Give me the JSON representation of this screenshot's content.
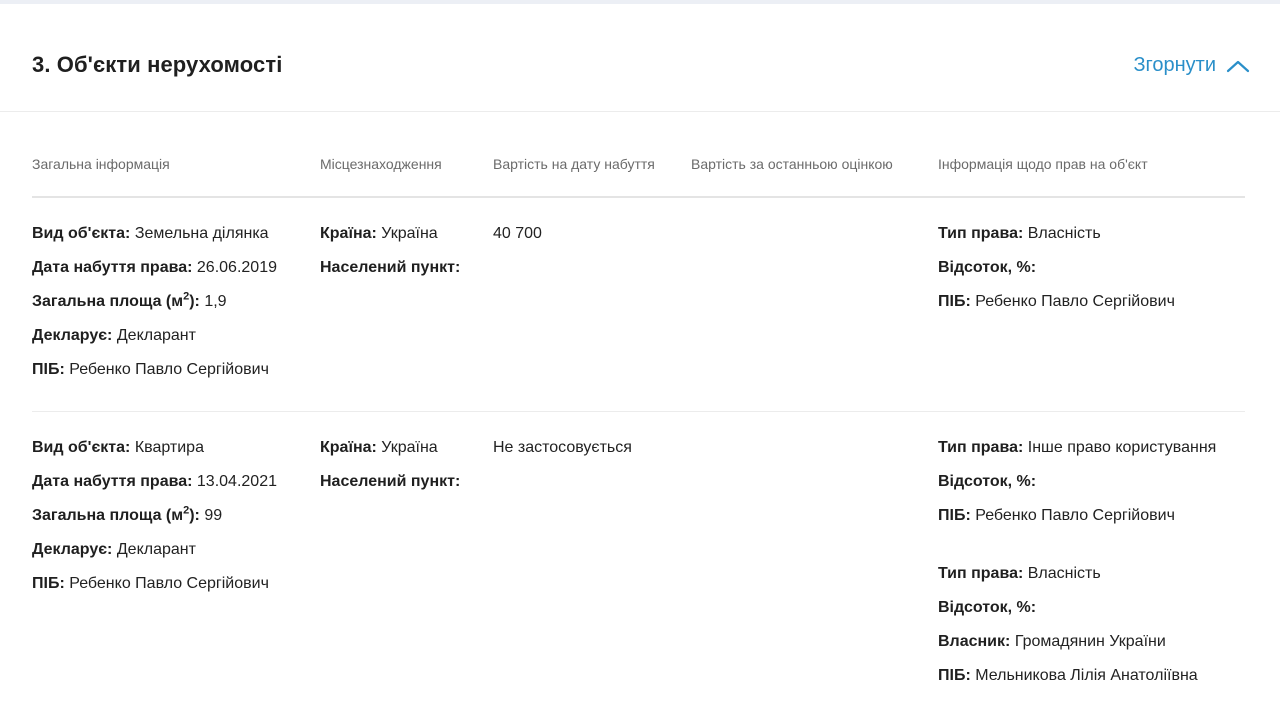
{
  "section": {
    "title": "3. Об'єкти нерухомості",
    "collapse_label": "Згорнути"
  },
  "columns": [
    "Загальна інформація",
    "Місцезнаходження",
    "Вартість на дату набуття",
    "Вартість за останньою оцінкою",
    "Інформація щодо прав на об'єкт"
  ],
  "labels": {
    "object_type": "Вид об'єкта:",
    "acquired_date": "Дата набуття права:",
    "area": "Загальна площа (м",
    "area_sup": "2",
    "area_end": "):",
    "declares": "Декларує:",
    "pib": "ПІБ:",
    "country": "Країна:",
    "settlement": "Населений пункт:",
    "right_type": "Тип права:",
    "percent": "Відсоток, %:",
    "owner": "Власник:"
  },
  "rows": [
    {
      "object_type": "Земельна ділянка",
      "acquired_date": "26.06.2019",
      "area": "1,9",
      "declares": "Декларант",
      "pib": "Ребенко Павло Сергійович",
      "country": "Україна",
      "settlement": "",
      "cost_acquired": "40 700",
      "cost_last": "",
      "rights": [
        {
          "type": "Власність",
          "percent": "",
          "owner": "",
          "pib": "Ребенко Павло Сергійович"
        }
      ]
    },
    {
      "object_type": "Квартира",
      "acquired_date": "13.04.2021",
      "area": "99",
      "declares": "Декларант",
      "pib": "Ребенко Павло Сергійович",
      "country": "Україна",
      "settlement": "",
      "cost_acquired": "Не застосовується",
      "cost_last": "",
      "rights": [
        {
          "type": "Інше право користування",
          "percent": "",
          "owner": "",
          "pib": "Ребенко Павло Сергійович"
        },
        {
          "type": "Власність",
          "percent": "",
          "owner": "Громадянин України",
          "pib": "Мельникова Лілія Анатоліївна"
        }
      ]
    }
  ],
  "colors": {
    "accent": "#2a8fc9",
    "text": "#222222",
    "muted": "#6b6b6b",
    "divider": "#e4e4e4"
  }
}
